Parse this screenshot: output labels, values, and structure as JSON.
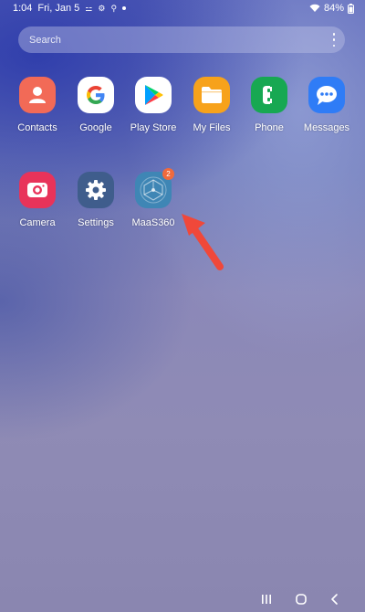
{
  "status_bar": {
    "time": "1:04",
    "date": "Fri, Jan 5",
    "battery": "84%"
  },
  "search": {
    "placeholder": "Search"
  },
  "apps": {
    "contacts": {
      "label": "Contacts",
      "color": "#f26a57"
    },
    "google": {
      "label": "Google",
      "color": "#ffffff"
    },
    "play_store": {
      "label": "Play Store",
      "color": "#ffffff"
    },
    "my_files": {
      "label": "My Files",
      "color": "#f7a21b"
    },
    "phone": {
      "label": "Phone",
      "color": "#17a852"
    },
    "messages": {
      "label": "Messages",
      "color": "#2f7cf6"
    },
    "camera": {
      "label": "Camera",
      "color": "#e8335a"
    },
    "settings": {
      "label": "Settings",
      "color": "#3f5d8c"
    },
    "maas360": {
      "label": "MaaS360",
      "color": "#3f86b5",
      "badge": "2"
    }
  },
  "annotation": {
    "arrow_color": "#f0483a"
  }
}
